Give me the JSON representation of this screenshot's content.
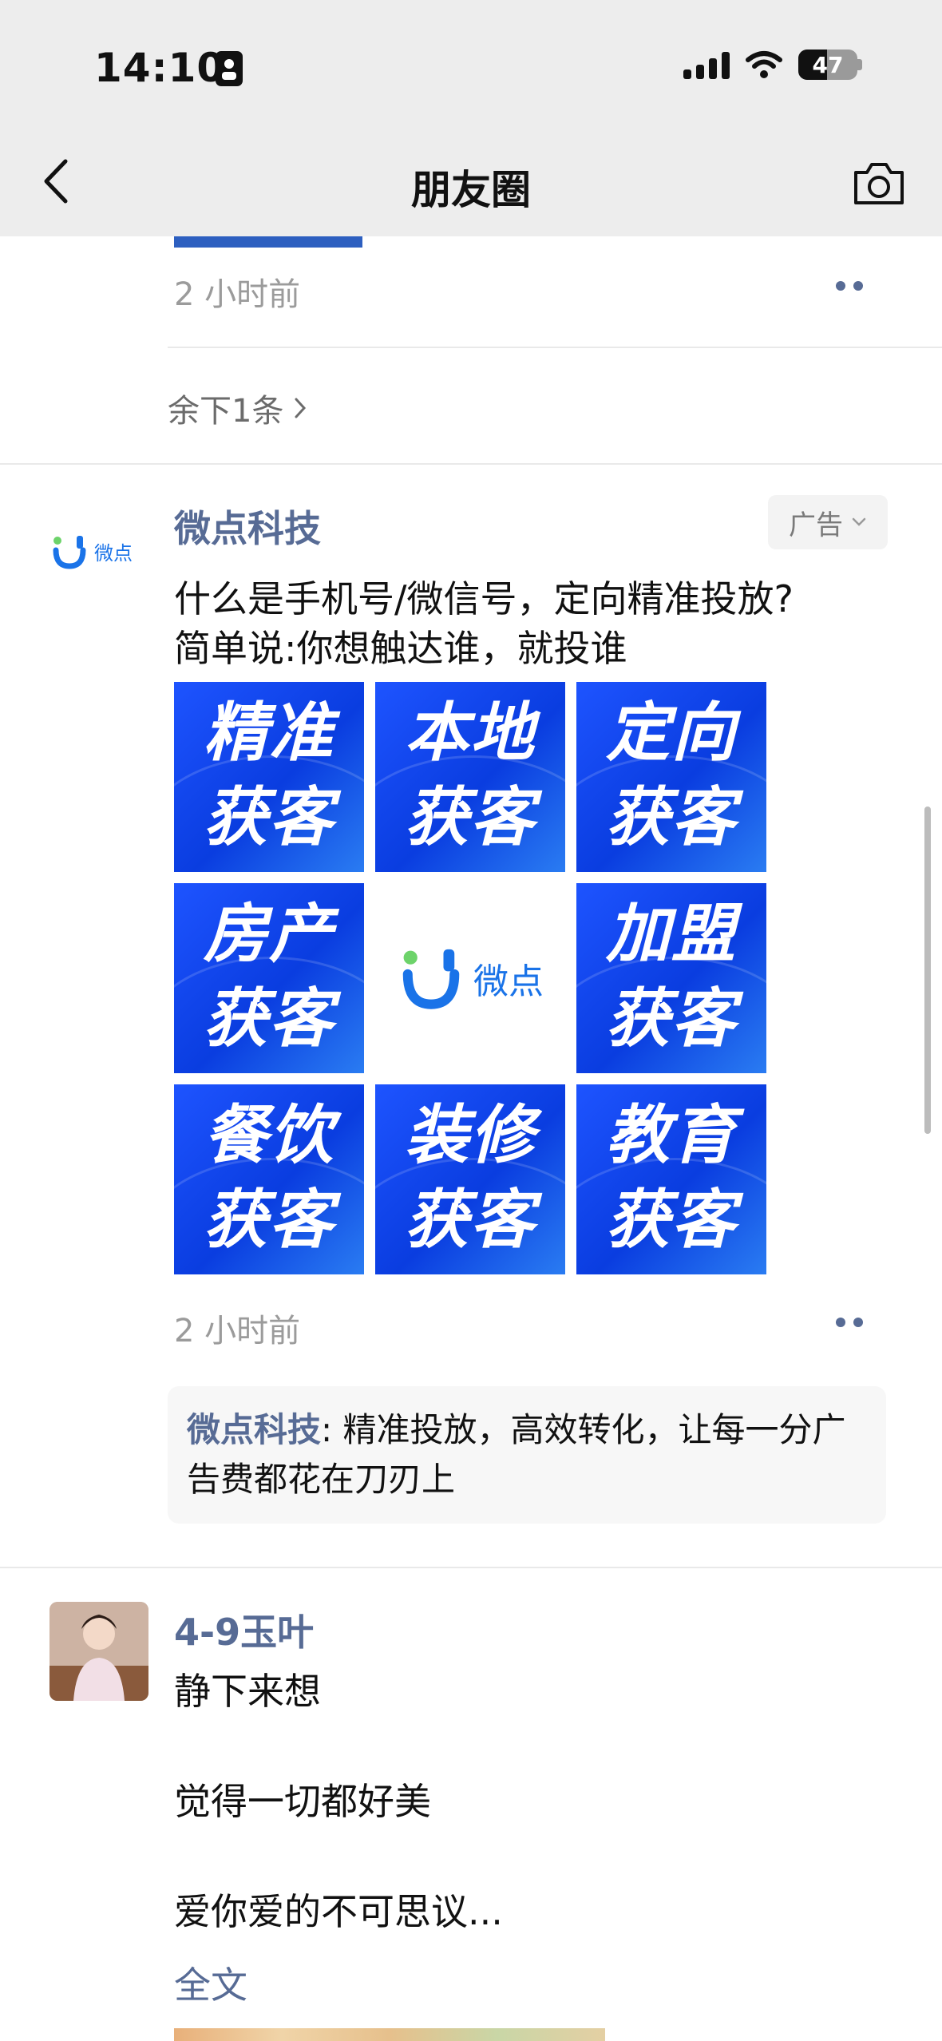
{
  "status_bar": {
    "time": "14:10",
    "battery": "47"
  },
  "nav": {
    "title": "朋友圈",
    "back_icon": "chevron-left-icon",
    "camera_icon": "camera-icon"
  },
  "post_prev": {
    "time_ago": "2 小时前",
    "more_replies": "余下1条"
  },
  "ad_post": {
    "author": "微点科技",
    "ad_label": "广告",
    "text_line1": "什么是手机号/微信号，定向精准投放?",
    "text_line2": "简单说:你想触达谁，就投谁",
    "logo_text": "微点",
    "tiles": [
      {
        "line1": "精准",
        "line2": "获客"
      },
      {
        "line1": "本地",
        "line2": "获客"
      },
      {
        "line1": "定向",
        "line2": "获客"
      },
      {
        "line1": "房产",
        "line2": "获客"
      },
      {
        "line1": "加盟",
        "line2": "获客"
      },
      {
        "line1": "餐饮",
        "line2": "获客"
      },
      {
        "line1": "装修",
        "line2": "获客"
      },
      {
        "line1": "教育",
        "line2": "获客"
      }
    ],
    "time_ago": "2 小时前",
    "comment": {
      "author": "微点科技",
      "text": ": 精准投放，高效转化，让每一分广告费都花在刀刃上"
    }
  },
  "post_next": {
    "author": "4-9玉叶",
    "lines": [
      "静下来想",
      "觉得一切都好美",
      "爱你爱的不可思议..."
    ],
    "full_text_link": "全文"
  },
  "colors": {
    "link": "#576b95",
    "tile_blue": "#1e54ff",
    "header_bg": "#ededed"
  }
}
